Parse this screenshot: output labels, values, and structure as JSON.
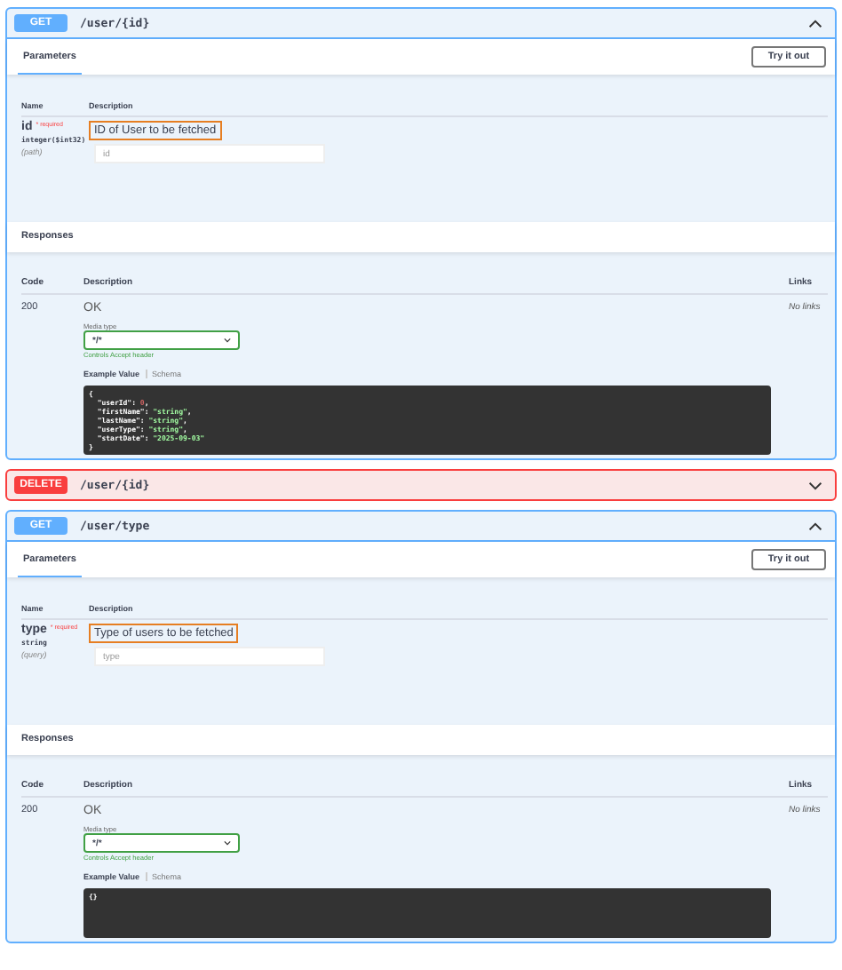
{
  "operations": [
    {
      "method": "GET",
      "kind": "get",
      "path": "/user/{id}",
      "expanded": true,
      "tab": "Parameters",
      "try_button": "Try it out",
      "param_columns": [
        "Name",
        "Description"
      ],
      "params": [
        {
          "name": "id",
          "required_mark": "* required",
          "type": "integer($int32)",
          "location": "(path)",
          "description": "ID of User to be fetched",
          "placeholder": "id"
        }
      ],
      "responses_title": "Responses",
      "response_columns": [
        "Code",
        "Description",
        "Links"
      ],
      "responses": [
        {
          "code": "200",
          "description": "OK",
          "media_label": "Media type",
          "media_value": "*/*",
          "media_hint": "Controls Accept header",
          "links": "No links",
          "example_tabs": [
            {
              "label": "Example Value",
              "selected": true
            },
            {
              "label": "Schema",
              "selected": false
            }
          ],
          "example_lines": [
            [
              {
                "text": "{",
                "kind": "punct"
              }
            ],
            [
              {
                "text": "  \"userId\"",
                "kind": "key"
              },
              {
                "text": ": ",
                "kind": "punct"
              },
              {
                "text": "0",
                "kind": "number"
              },
              {
                "text": ",",
                "kind": "punct"
              }
            ],
            [
              {
                "text": "  \"firstName\"",
                "kind": "key"
              },
              {
                "text": ": ",
                "kind": "punct"
              },
              {
                "text": "\"string\"",
                "kind": "string"
              },
              {
                "text": ",",
                "kind": "punct"
              }
            ],
            [
              {
                "text": "  \"lastName\"",
                "kind": "key"
              },
              {
                "text": ": ",
                "kind": "punct"
              },
              {
                "text": "\"string\"",
                "kind": "string"
              },
              {
                "text": ",",
                "kind": "punct"
              }
            ],
            [
              {
                "text": "  \"userType\"",
                "kind": "key"
              },
              {
                "text": ": ",
                "kind": "punct"
              },
              {
                "text": "\"string\"",
                "kind": "string"
              },
              {
                "text": ",",
                "kind": "punct"
              }
            ],
            [
              {
                "text": "  \"startDate\"",
                "kind": "key"
              },
              {
                "text": ": ",
                "kind": "punct"
              },
              {
                "text": "\"2025-09-03\"",
                "kind": "string"
              }
            ],
            [
              {
                "text": "}",
                "kind": "punct"
              }
            ]
          ]
        }
      ]
    },
    {
      "method": "DELETE",
      "kind": "delete",
      "path": "/user/{id}",
      "expanded": false
    },
    {
      "method": "GET",
      "kind": "get",
      "path": "/user/type",
      "expanded": true,
      "tab": "Parameters",
      "try_button": "Try it out",
      "param_columns": [
        "Name",
        "Description"
      ],
      "params": [
        {
          "name": "type",
          "required_mark": "* required",
          "type": "string",
          "location": "(query)",
          "description": "Type of users to be fetched",
          "placeholder": "type"
        }
      ],
      "responses_title": "Responses",
      "response_columns": [
        "Code",
        "Description",
        "Links"
      ],
      "responses": [
        {
          "code": "200",
          "description": "OK",
          "media_label": "Media type",
          "media_value": "*/*",
          "media_hint": "Controls Accept header",
          "links": "No links",
          "example_tabs": [
            {
              "label": "Example Value",
              "selected": true
            },
            {
              "label": "Schema",
              "selected": false
            }
          ],
          "example_lines": [
            [
              {
                "text": "{}",
                "kind": "punct"
              }
            ]
          ]
        }
      ]
    }
  ]
}
